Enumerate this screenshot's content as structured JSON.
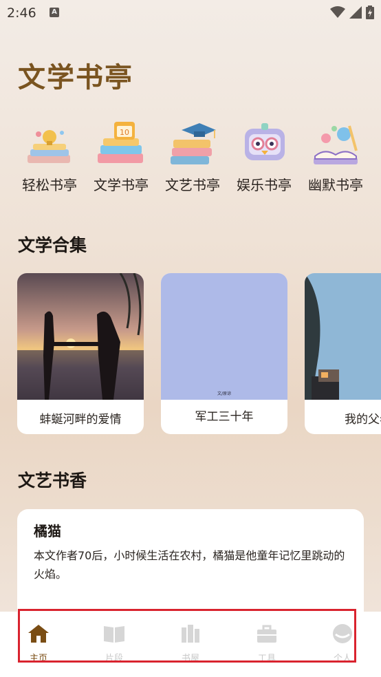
{
  "status": {
    "time": "2:46",
    "a_icon": "A"
  },
  "header": {
    "title": "文学书亭"
  },
  "categories": [
    {
      "label": "轻松书亭",
      "icon": "trophy-books-icon"
    },
    {
      "label": "文学书亭",
      "icon": "calendar-books-icon"
    },
    {
      "label": "文艺书亭",
      "icon": "graduation-cap-books-icon"
    },
    {
      "label": "娱乐书亭",
      "icon": "robot-glasses-icon"
    },
    {
      "label": "幽默书亭",
      "icon": "open-book-tools-icon"
    }
  ],
  "collection": {
    "title": "文学合集",
    "books": [
      {
        "title": "蚌蜒河畔的爱情"
      },
      {
        "title": "军工三十年",
        "cover_text": "文/原谅"
      },
      {
        "title": "我的父老"
      }
    ]
  },
  "arts": {
    "title": "文艺书香",
    "card": {
      "title": "橘猫",
      "body": "本文作者70后，小时候生活在农村，橘猫是他童年记忆里跳动的火焰。"
    }
  },
  "tabs": [
    {
      "label": "主页",
      "icon": "home-icon",
      "active": true
    },
    {
      "label": "片段",
      "icon": "book-icon",
      "active": false
    },
    {
      "label": "书屋",
      "icon": "bookshelf-icon",
      "active": false
    },
    {
      "label": "工具",
      "icon": "toolbox-icon",
      "active": false
    },
    {
      "label": "个人",
      "icon": "profile-icon",
      "active": false
    }
  ],
  "colors": {
    "accent": "#7a5420",
    "tab_active": "#7a4d14",
    "tab_inactive": "#c8c8c8",
    "highlight": "#d9232e"
  }
}
